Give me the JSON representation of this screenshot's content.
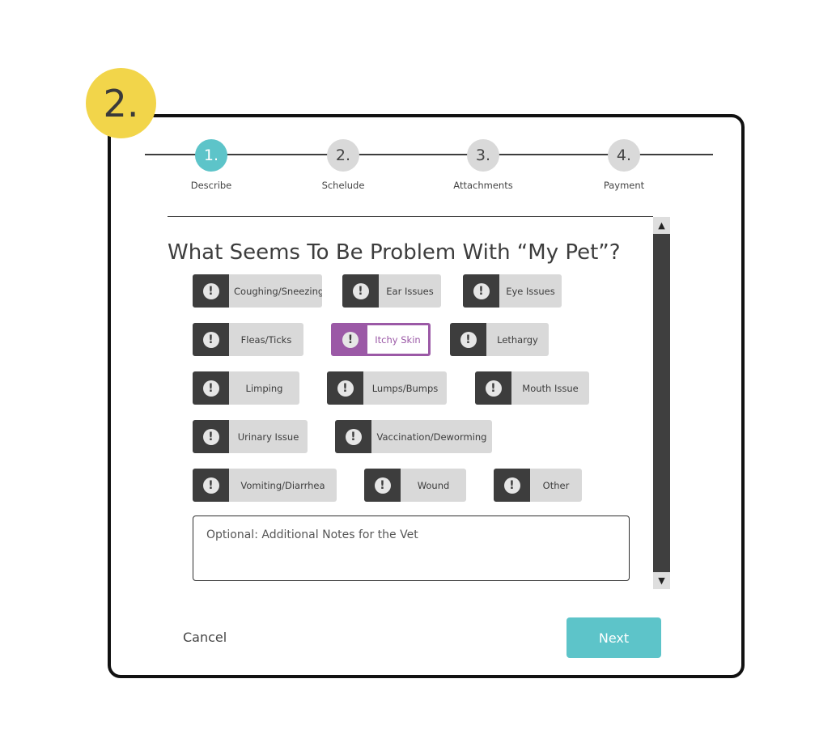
{
  "step_badge": "2.",
  "stepper": {
    "steps": [
      {
        "number": "1.",
        "label": "Describe"
      },
      {
        "number": "2.",
        "label": "Schelude"
      },
      {
        "number": "3.",
        "label": "Attachments"
      },
      {
        "number": "4.",
        "label": "Payment"
      }
    ],
    "active_step": 1
  },
  "question": "What Seems To Be Problem With “My Pet”?",
  "tag_icon": "exclamation-icon",
  "tags": [
    {
      "label": "Coughing/Sneezing"
    },
    {
      "label": "Ear Issues"
    },
    {
      "label": "Eye Issues"
    },
    {
      "label": "Fleas/Ticks"
    },
    {
      "label": "Itchy Skin",
      "selected": true
    },
    {
      "label": "Lethargy"
    },
    {
      "label": "Limping"
    },
    {
      "label": "Lumps/Bumps"
    },
    {
      "label": "Mouth Issue"
    },
    {
      "label": "Urinary Issue"
    },
    {
      "label": "Vaccination/Deworming"
    },
    {
      "label": "Vomiting/Diarrhea"
    },
    {
      "label": "Wound"
    },
    {
      "label": "Other"
    }
  ],
  "notes": {
    "placeholder": "Optional: Additional Notes for the Vet",
    "value": ""
  },
  "scrollbar": {
    "up": "▲",
    "down": "▼"
  },
  "actions": {
    "cancel": "Cancel",
    "next": "Next"
  },
  "colors": {
    "accent": "#5dc4c9",
    "selected": "#9b59a6",
    "badge": "#f2d54a",
    "tag_bg": "#d9d9d9",
    "tag_icon_bg": "#3d3d3d"
  }
}
